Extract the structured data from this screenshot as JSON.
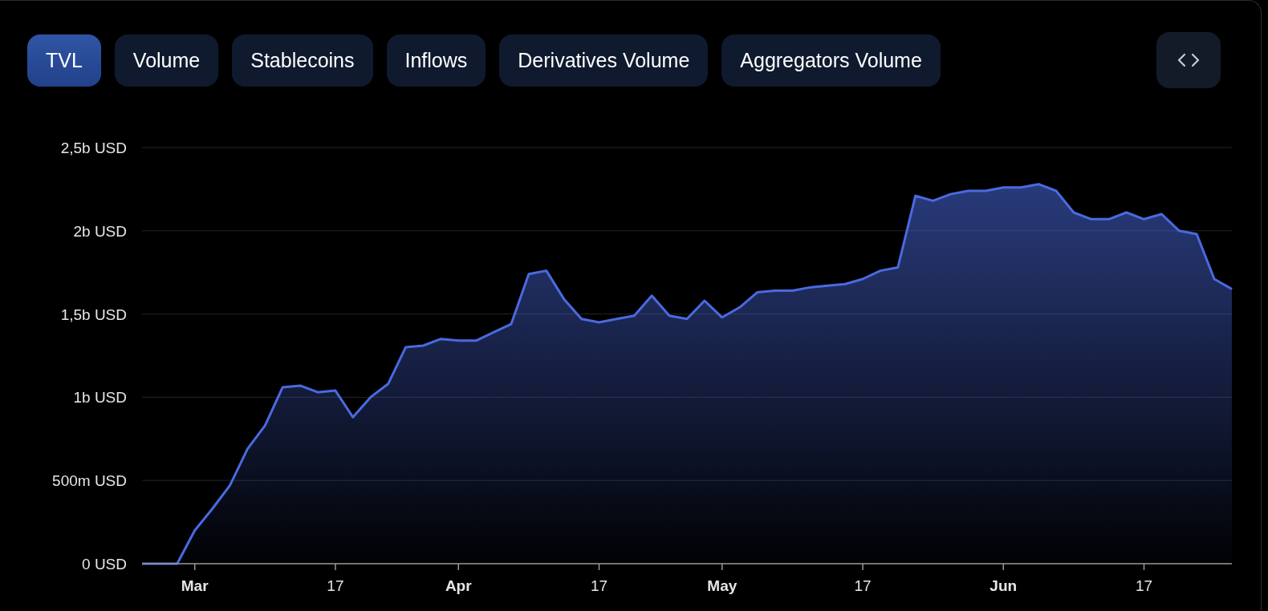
{
  "tabs": [
    {
      "label": "TVL",
      "selected": true
    },
    {
      "label": "Volume",
      "selected": false
    },
    {
      "label": "Stablecoins",
      "selected": false
    },
    {
      "label": "Inflows",
      "selected": false
    },
    {
      "label": "Derivatives Volume",
      "selected": false
    },
    {
      "label": "Aggregators Volume",
      "selected": false
    }
  ],
  "embed_button": {
    "kind": "code"
  },
  "chart": {
    "chart_data": {
      "type": "area",
      "grid": true,
      "ylim": [
        0,
        2500000000
      ],
      "yticks": [
        {
          "value": 0,
          "label": "0 USD"
        },
        {
          "value": 500000000,
          "label": "500m USD"
        },
        {
          "value": 1000000000,
          "label": "1b USD"
        },
        {
          "value": 1500000000,
          "label": "1,5b USD"
        },
        {
          "value": 2000000000,
          "label": "2b USD"
        },
        {
          "value": 2500000000,
          "label": "2,5b USD"
        }
      ],
      "categories": [
        null,
        null,
        null,
        "Mar",
        null,
        null,
        null,
        null,
        null,
        null,
        null,
        "17",
        null,
        null,
        null,
        null,
        null,
        null,
        "Apr",
        null,
        null,
        null,
        null,
        null,
        null,
        null,
        "17",
        null,
        null,
        null,
        null,
        null,
        null,
        "May",
        null,
        null,
        null,
        null,
        null,
        null,
        null,
        "17",
        null,
        null,
        null,
        null,
        null,
        null,
        null,
        "Jun",
        null,
        null,
        null,
        null,
        null,
        null,
        null,
        "17",
        null,
        null,
        null,
        null,
        null
      ],
      "series": [
        {
          "color": "#4a6ae0",
          "values": [
            0,
            0,
            0,
            200000000,
            330000000,
            470000000,
            690000000,
            830000000,
            1060000000,
            1070000000,
            1030000000,
            1040000000,
            880000000,
            1000000000,
            1080000000,
            1300000000,
            1310000000,
            1350000000,
            1340000000,
            1340000000,
            1390000000,
            1440000000,
            1740000000,
            1760000000,
            1590000000,
            1470000000,
            1450000000,
            1470000000,
            1490000000,
            1610000000,
            1490000000,
            1470000000,
            1580000000,
            1480000000,
            1540000000,
            1630000000,
            1640000000,
            1640000000,
            1660000000,
            1670000000,
            1680000000,
            1710000000,
            1760000000,
            1780000000,
            2210000000,
            2180000000,
            2220000000,
            2240000000,
            2240000000,
            2260000000,
            2260000000,
            2280000000,
            2240000000,
            2110000000,
            2070000000,
            2070000000,
            2110000000,
            2070000000,
            2100000000,
            2000000000,
            1980000000,
            1710000000,
            1650000000
          ]
        }
      ]
    }
  }
}
